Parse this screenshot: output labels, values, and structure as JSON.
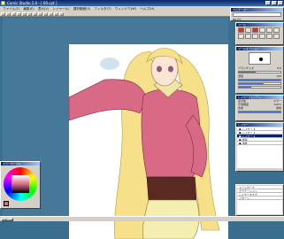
{
  "titlebar": {
    "title": "Comic Studio 2.0 - [ 00.cpt ]"
  },
  "menubar": {
    "items": [
      "ファイル(F)",
      "編集(E)",
      "表示(V)",
      "レイヤー(L)",
      "選択範囲(S)",
      "フィルタ(T)",
      "ウィンドウ(W)",
      "ヘルプ(H)"
    ]
  },
  "navigator": {
    "title": "ナビゲーター",
    "zoom": "66.7%"
  },
  "tools": {
    "title": "ツール"
  },
  "tool_options": {
    "title": "ツールオプション",
    "brush_size_label": "ブラシサイズ",
    "density_label": "濃度",
    "brush_size": "8.0",
    "density": "100"
  },
  "layer_properties": {
    "title": "レイヤープロパティ",
    "rows": [
      {
        "label": "表示色",
        "value": "カラー"
      },
      {
        "label": "不透明度",
        "value": "100%"
      },
      {
        "label": "合成",
        "value": "通常"
      }
    ]
  },
  "layers": {
    "title": "レイヤー",
    "items": [
      "レイヤー 4",
      "レイヤー 3",
      "レイヤー 2",
      "線画",
      "用紙"
    ]
  },
  "color_panel": {
    "title": "カラーサークル"
  },
  "bottom_list": {
    "items": [
      "トーンカーブ",
      "グラデーション",
      "レイヤーマスク",
      "パターン"
    ]
  },
  "taskbar": {
    "start": "スタート"
  },
  "colors": {
    "canvas_bg": "#46789a",
    "titlebar": "#0a246a",
    "hair": "#f6e08a",
    "jacket": "#d86a86",
    "corset": "#5a2a22",
    "skirt": "#f4efb0"
  }
}
